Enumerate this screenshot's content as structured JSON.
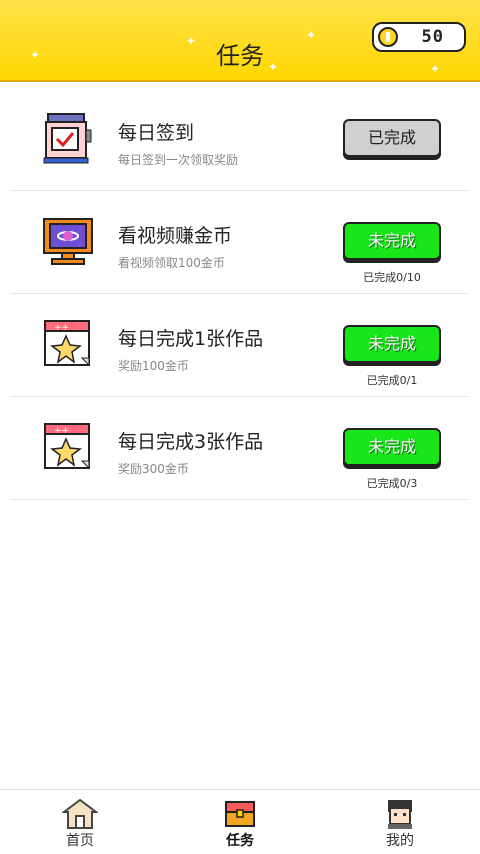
{
  "header": {
    "title": "任务",
    "coins": "50"
  },
  "tasks": [
    {
      "name": "每日签到",
      "desc": "每日签到一次领取奖励",
      "button": "已完成",
      "status": "done",
      "progress": ""
    },
    {
      "name": "看视频赚金币",
      "desc": "看视频领取100金币",
      "button": "未完成",
      "status": "todo",
      "progress": "已完成0/10"
    },
    {
      "name": "每日完成1张作品",
      "desc": "奖励100金币",
      "button": "未完成",
      "status": "todo",
      "progress": "已完成0/1"
    },
    {
      "name": "每日完成3张作品",
      "desc": "奖励300金币",
      "button": "未完成",
      "status": "todo",
      "progress": "已完成0/3"
    }
  ],
  "nav": [
    {
      "label": "首页",
      "icon": "home-icon"
    },
    {
      "label": "任务",
      "icon": "treasure-chest-icon"
    },
    {
      "label": "我的",
      "icon": "profile-avatar-icon"
    }
  ],
  "colors": {
    "header": "#ffd700",
    "done_button": "#d0d0d0",
    "todo_button": "#19e619"
  }
}
